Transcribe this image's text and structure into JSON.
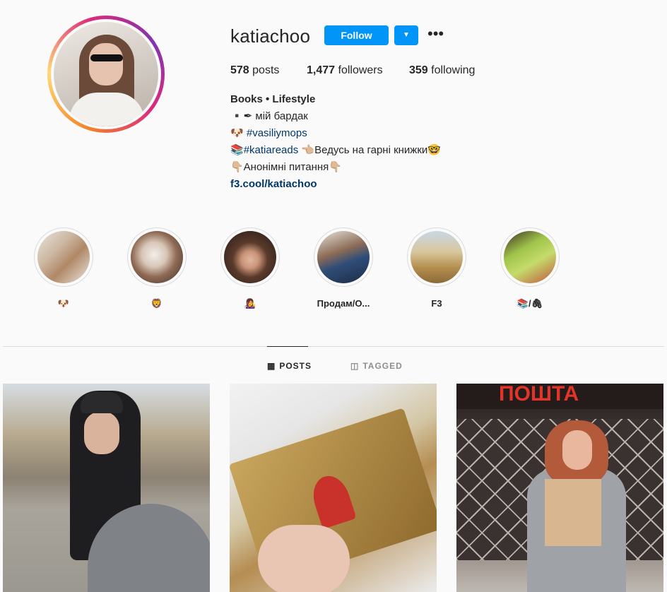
{
  "profile": {
    "username": "katiachoo",
    "follow_label": "Follow",
    "dropdown_icon": "▼",
    "more_icon": "•••",
    "stats": {
      "posts_count": "578",
      "posts_label": "posts",
      "followers_count": "1,477",
      "followers_label": "followers",
      "following_count": "359",
      "following_label": "following"
    },
    "bio": {
      "name": "Books • Lifestyle",
      "line1": "▪️✒ мій бардак",
      "line2_emoji": "🐶",
      "line2_tag": "#vasiliymops",
      "line3_emoji": "📚",
      "line3_tag": "#katiareads",
      "line3_text": "👈🏼Ведусь на гарні книжки🤓",
      "line4": "👇🏼Анонімні питання👇🏼",
      "link": "f3.cool/katiachoo"
    }
  },
  "highlights": [
    {
      "label": "🐶"
    },
    {
      "label": "🦁"
    },
    {
      "label": "👩‍🎤"
    },
    {
      "label": "Продам/О..."
    },
    {
      "label": "F3"
    },
    {
      "label": "📚/🖇"
    }
  ],
  "tabs": {
    "posts_icon": "▦",
    "posts": "POSTS",
    "tagged_icon": "◫",
    "tagged": "TAGGED"
  },
  "posts_overlay": {
    "sign_text": "ПОШТА"
  },
  "colors": {
    "accent": "#0095f6",
    "link": "#00376b",
    "text": "#262626",
    "muted": "#8e8e8e",
    "border": "#dbdbdb"
  }
}
